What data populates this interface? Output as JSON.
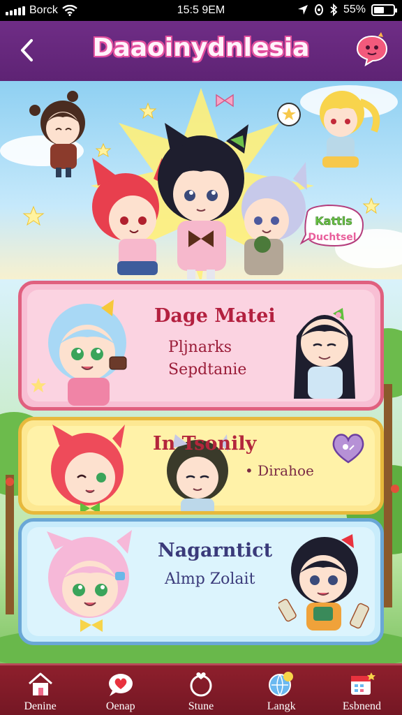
{
  "status_bar": {
    "carrier": "Borck",
    "time": "15:5 9EM",
    "battery": "55%",
    "battery_level": 0.55
  },
  "header": {
    "title": "Daaoinydnlesia",
    "back_icon": "chevron-left-icon",
    "chat_icon": "chat-bubble-icon"
  },
  "hero": {
    "speech_text_1": "Kattls",
    "speech_text_2": "Duchtsel"
  },
  "cards": [
    {
      "title": "Dage Matei",
      "lines": [
        "Pljnarks",
        "Sepdtanie"
      ],
      "color": "#f8bfd4",
      "border": "#e0607f"
    },
    {
      "title": "In      Tsonily",
      "lines": [
        "• Dirahoe"
      ],
      "color": "#fde892",
      "border": "#e7b93c",
      "badge_icon": "heart-icon"
    },
    {
      "title": "Nagarntict",
      "lines": [
        "Almp Zolait"
      ],
      "color": "#c8ecfb",
      "border": "#6aa7d6"
    }
  ],
  "nav": [
    {
      "label": "Denine",
      "icon": "home-icon"
    },
    {
      "label": "Oenap",
      "icon": "heart-chat-icon"
    },
    {
      "label": "Stune",
      "icon": "heart-ring-icon"
    },
    {
      "label": "Langk",
      "icon": "globe-chat-icon"
    },
    {
      "label": "Esbnend",
      "icon": "calendar-icon"
    }
  ]
}
